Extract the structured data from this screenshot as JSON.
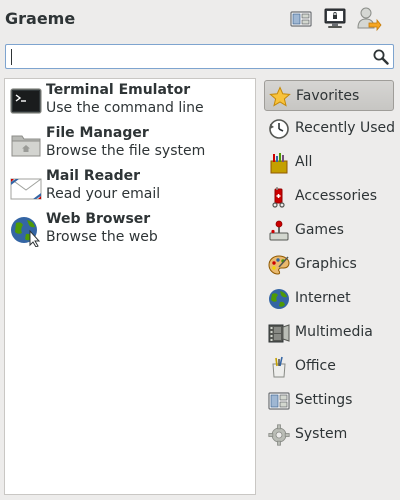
{
  "header": {
    "username": "Graeme",
    "icons": [
      "settings-icon",
      "lock-screen-icon",
      "logout-icon"
    ]
  },
  "search": {
    "value": "",
    "placeholder": "",
    "icon": "magnifier-icon"
  },
  "favorites": [
    {
      "name": "Terminal Emulator",
      "description": "Use the command line",
      "icon": "terminal-icon"
    },
    {
      "name": "File Manager",
      "description": "Browse the file system",
      "icon": "folder-icon"
    },
    {
      "name": "Mail Reader",
      "description": "Read your email",
      "icon": "mail-icon"
    },
    {
      "name": "Web Browser",
      "description": "Browse the web",
      "icon": "globe-icon"
    }
  ],
  "categories": [
    {
      "label": "Favorites",
      "icon": "star-icon",
      "selected": true
    },
    {
      "label": "Recently Used",
      "icon": "clock-icon",
      "selected": false
    },
    {
      "label": "All",
      "icon": "all-icon",
      "selected": false
    },
    {
      "label": "Accessories",
      "icon": "accessories-icon",
      "selected": false
    },
    {
      "label": "Games",
      "icon": "joystick-icon",
      "selected": false
    },
    {
      "label": "Graphics",
      "icon": "palette-icon",
      "selected": false
    },
    {
      "label": "Internet",
      "icon": "globe-icon",
      "selected": false
    },
    {
      "label": "Multimedia",
      "icon": "film-icon",
      "selected": false
    },
    {
      "label": "Office",
      "icon": "office-icon",
      "selected": false
    },
    {
      "label": "Settings",
      "icon": "settings-icon",
      "selected": false
    },
    {
      "label": "System",
      "icon": "gear-icon",
      "selected": false
    }
  ],
  "colors": {
    "background": "#edeceb",
    "selected_category": "#cfcecb",
    "search_border": "#7ea4cf"
  }
}
